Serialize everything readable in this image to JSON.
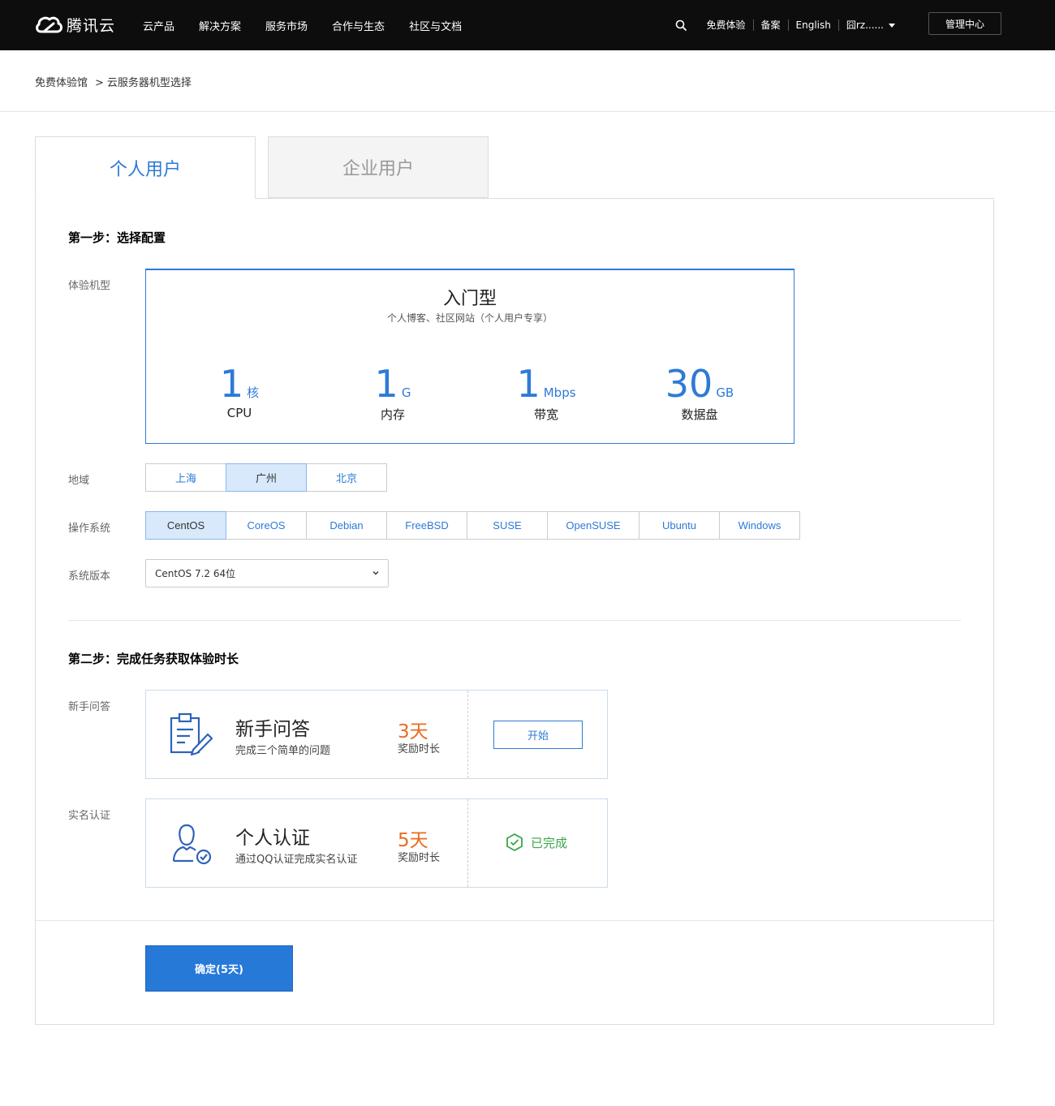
{
  "brand": {
    "name": "腾讯云"
  },
  "nav": {
    "links": [
      "云产品",
      "解决方案",
      "服务市场",
      "合作与生态",
      "社区与文档"
    ],
    "right": [
      "免费体验",
      "备案",
      "English",
      "囧rz......"
    ],
    "console": "管理中心"
  },
  "breadcrumb": {
    "root": "免费体验馆",
    "separator": ">",
    "current": "云服务器机型选择"
  },
  "tabs": {
    "personal": "个人用户",
    "enterprise": "企业用户"
  },
  "step1": {
    "title": "第一步：选择配置",
    "model_label": "体验机型",
    "spec": {
      "name": "入门型",
      "desc": "个人博客、社区网站（个人用户专享）",
      "items": [
        {
          "value": "1",
          "unit": "核",
          "label": "CPU"
        },
        {
          "value": "1",
          "unit": "G",
          "label": "内存"
        },
        {
          "value": "1",
          "unit": "Mbps",
          "label": "带宽"
        },
        {
          "value": "30",
          "unit": "GB",
          "label": "数据盘"
        }
      ]
    },
    "region_label": "地域",
    "regions": [
      "上海",
      "广州",
      "北京"
    ],
    "region_selected": "广州",
    "os_label": "操作系统",
    "os": [
      "CentOS",
      "CoreOS",
      "Debian",
      "FreeBSD",
      "SUSE",
      "OpenSUSE",
      "Ubuntu",
      "Windows"
    ],
    "os_selected": "CentOS",
    "version_label": "系统版本",
    "version_value": "CentOS 7.2 64位"
  },
  "step2": {
    "title": "第二步：完成任务获取体验时长",
    "tasks": [
      {
        "row_label": "新手问答",
        "title": "新手问答",
        "desc": "完成三个简单的问题",
        "days": "3天",
        "days_label": "奖励时长",
        "action": "开始"
      },
      {
        "row_label": "实名认证",
        "title": "个人认证",
        "desc": "通过QQ认证完成实名认证",
        "days": "5天",
        "days_label": "奖励时长",
        "status": "已完成"
      }
    ]
  },
  "confirm": "确定(5天)",
  "colors": {
    "accent": "#2e7ad6",
    "orange": "#ea6c1e",
    "success": "#3aa64a",
    "nav_bg": "#0d0d0d"
  },
  "icons": [
    "tencent-cloud-logo-icon",
    "search-icon",
    "caret-down-icon",
    "chevron-down-icon",
    "clipboard-edit-icon",
    "user-verified-icon",
    "check-shield-icon"
  ]
}
